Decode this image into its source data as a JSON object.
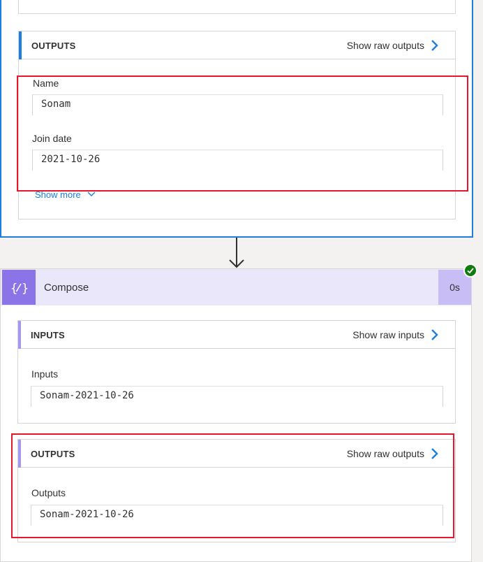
{
  "top_step": {
    "outputs_section": {
      "title": "OUTPUTS",
      "raw_link": "Show raw outputs",
      "fields": [
        {
          "label": "Name",
          "value": "Sonam"
        },
        {
          "label": "Join date",
          "value": "2021-10-26"
        }
      ],
      "show_more": "Show more"
    }
  },
  "compose_step": {
    "title": "Compose",
    "duration": "0s",
    "status": "succeeded",
    "inputs_section": {
      "title": "INPUTS",
      "raw_link": "Show raw inputs",
      "fields": [
        {
          "label": "Inputs",
          "value": "Sonam-2021-10-26"
        }
      ]
    },
    "outputs_section": {
      "title": "OUTPUTS",
      "raw_link": "Show raw outputs",
      "fields": [
        {
          "label": "Outputs",
          "value": "Sonam-2021-10-26"
        }
      ]
    }
  },
  "colors": {
    "accent_blue": "#1a7fe0",
    "compose_purple": "#8a74e8",
    "highlight_red": "#e8162d",
    "success_green": "#107c10"
  }
}
